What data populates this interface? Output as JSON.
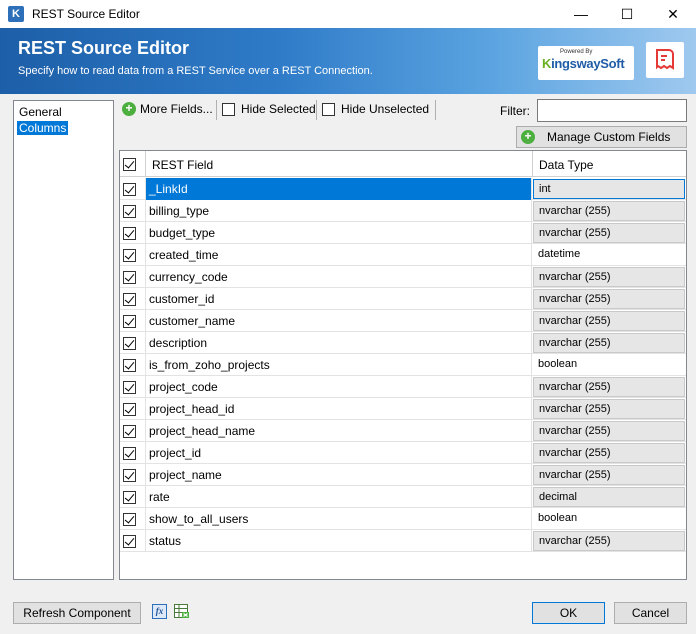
{
  "window": {
    "icon_letter": "K",
    "title": "REST Source Editor",
    "controls": [
      "—",
      "☐",
      "✕"
    ]
  },
  "banner": {
    "title": "REST Source Editor",
    "subtitle": "Specify how to read data from a REST Service over a REST Connection.",
    "logo_powered": "Powered By",
    "logo_brand_k": "K",
    "logo_brand_rest": "ingswaySoft"
  },
  "nav": {
    "items": [
      {
        "label": "General",
        "selected": false
      },
      {
        "label": "Columns",
        "selected": true
      }
    ]
  },
  "toolbar": {
    "more_fields": "More Fields...",
    "hide_selected": "Hide Selected",
    "hide_unselected": "Hide Unselected",
    "filter_label": "Filter:",
    "filter_value": "",
    "manage_custom_fields": "Manage Custom Fields"
  },
  "grid": {
    "header_checked": true,
    "col_field": "REST Field",
    "col_type": "Data Type",
    "rows": [
      {
        "field": "_LinkId",
        "type": "int",
        "checked": true,
        "gray": true,
        "selected": true
      },
      {
        "field": "billing_type",
        "type": "nvarchar (255)",
        "checked": true,
        "gray": true
      },
      {
        "field": "budget_type",
        "type": "nvarchar (255)",
        "checked": true,
        "gray": true
      },
      {
        "field": "created_time",
        "type": "datetime",
        "checked": true,
        "gray": false
      },
      {
        "field": "currency_code",
        "type": "nvarchar (255)",
        "checked": true,
        "gray": true
      },
      {
        "field": "customer_id",
        "type": "nvarchar (255)",
        "checked": true,
        "gray": true
      },
      {
        "field": "customer_name",
        "type": "nvarchar (255)",
        "checked": true,
        "gray": true
      },
      {
        "field": "description",
        "type": "nvarchar (255)",
        "checked": true,
        "gray": true
      },
      {
        "field": "is_from_zoho_projects",
        "type": "boolean",
        "checked": true,
        "gray": false
      },
      {
        "field": "project_code",
        "type": "nvarchar (255)",
        "checked": true,
        "gray": true
      },
      {
        "field": "project_head_id",
        "type": "nvarchar (255)",
        "checked": true,
        "gray": true
      },
      {
        "field": "project_head_name",
        "type": "nvarchar (255)",
        "checked": true,
        "gray": true
      },
      {
        "field": "project_id",
        "type": "nvarchar (255)",
        "checked": true,
        "gray": true
      },
      {
        "field": "project_name",
        "type": "nvarchar (255)",
        "checked": true,
        "gray": true
      },
      {
        "field": "rate",
        "type": "decimal",
        "checked": true,
        "gray": true
      },
      {
        "field": "show_to_all_users",
        "type": "boolean",
        "checked": true,
        "gray": false
      },
      {
        "field": "status",
        "type": "nvarchar (255)",
        "checked": true,
        "gray": true
      }
    ]
  },
  "footer": {
    "refresh": "Refresh Component",
    "fx_icon_text": "fx",
    "ok": "OK",
    "cancel": "Cancel"
  }
}
